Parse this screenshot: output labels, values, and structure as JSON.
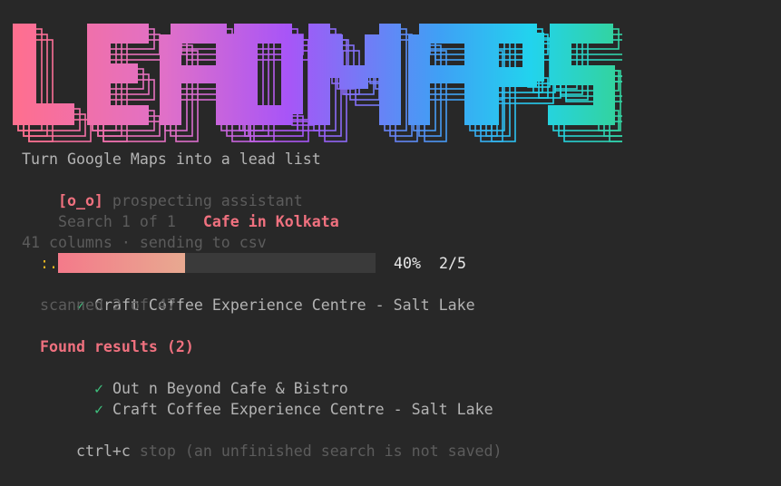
{
  "logo": {
    "text": "LEADMAPS",
    "gradient": [
      "#ff6f8e",
      "#a855f7",
      "#22d3ee",
      "#34d399"
    ]
  },
  "header": {
    "tagline": "Turn Google Maps into a lead list",
    "mascot": "[o_o]",
    "assistant_label": "prospecting assistant",
    "search_counter": "Search 1 of 1",
    "search_query": "Cafe in Kolkata"
  },
  "progress": {
    "columns_text": "41 columns · sending to csv",
    "spinner": ":.",
    "fraction": 0.4,
    "percent_text": "40%",
    "count_text": "2/5",
    "current_item": "Craft Coffee Experience Centre - Salt Lake",
    "scanned_text": "scanned 2 of 47"
  },
  "results": {
    "heading": "Found results (2)",
    "items": [
      "Out n Beyond Cafe & Bistro",
      "Craft Coffee Experience Centre - Salt Lake"
    ]
  },
  "footer": {
    "shortcut": "ctrl+c",
    "hint": "stop (an unfinished search is not saved)"
  },
  "icons": {
    "check": "✓"
  },
  "colors": {
    "background": "#282828",
    "accent_pink": "#f0717f",
    "check_green": "#3ec07d",
    "spinner_yellow": "#e6b422"
  }
}
